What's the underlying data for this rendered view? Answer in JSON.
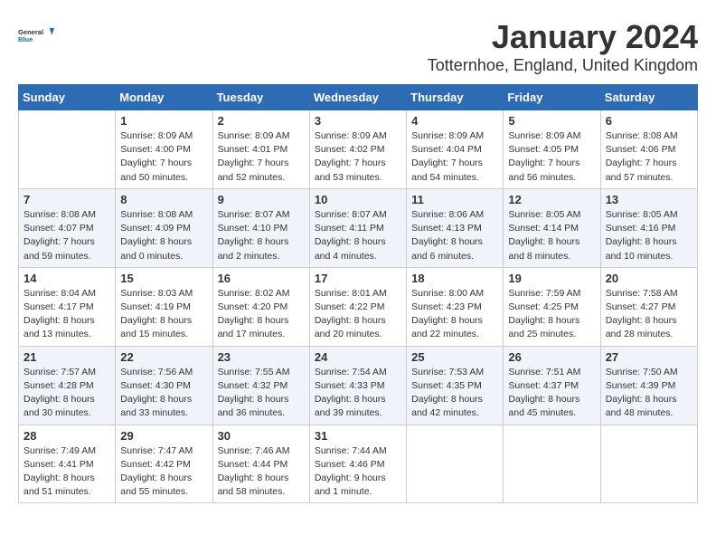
{
  "header": {
    "logo_general": "General",
    "logo_blue": "Blue",
    "month": "January 2024",
    "location": "Totternhoe, England, United Kingdom"
  },
  "days_of_week": [
    "Sunday",
    "Monday",
    "Tuesday",
    "Wednesday",
    "Thursday",
    "Friday",
    "Saturday"
  ],
  "weeks": [
    [
      {
        "day": "",
        "info": ""
      },
      {
        "day": "1",
        "info": "Sunrise: 8:09 AM\nSunset: 4:00 PM\nDaylight: 7 hours\nand 50 minutes."
      },
      {
        "day": "2",
        "info": "Sunrise: 8:09 AM\nSunset: 4:01 PM\nDaylight: 7 hours\nand 52 minutes."
      },
      {
        "day": "3",
        "info": "Sunrise: 8:09 AM\nSunset: 4:02 PM\nDaylight: 7 hours\nand 53 minutes."
      },
      {
        "day": "4",
        "info": "Sunrise: 8:09 AM\nSunset: 4:04 PM\nDaylight: 7 hours\nand 54 minutes."
      },
      {
        "day": "5",
        "info": "Sunrise: 8:09 AM\nSunset: 4:05 PM\nDaylight: 7 hours\nand 56 minutes."
      },
      {
        "day": "6",
        "info": "Sunrise: 8:08 AM\nSunset: 4:06 PM\nDaylight: 7 hours\nand 57 minutes."
      }
    ],
    [
      {
        "day": "7",
        "info": "Sunrise: 8:08 AM\nSunset: 4:07 PM\nDaylight: 7 hours\nand 59 minutes."
      },
      {
        "day": "8",
        "info": "Sunrise: 8:08 AM\nSunset: 4:09 PM\nDaylight: 8 hours\nand 0 minutes."
      },
      {
        "day": "9",
        "info": "Sunrise: 8:07 AM\nSunset: 4:10 PM\nDaylight: 8 hours\nand 2 minutes."
      },
      {
        "day": "10",
        "info": "Sunrise: 8:07 AM\nSunset: 4:11 PM\nDaylight: 8 hours\nand 4 minutes."
      },
      {
        "day": "11",
        "info": "Sunrise: 8:06 AM\nSunset: 4:13 PM\nDaylight: 8 hours\nand 6 minutes."
      },
      {
        "day": "12",
        "info": "Sunrise: 8:05 AM\nSunset: 4:14 PM\nDaylight: 8 hours\nand 8 minutes."
      },
      {
        "day": "13",
        "info": "Sunrise: 8:05 AM\nSunset: 4:16 PM\nDaylight: 8 hours\nand 10 minutes."
      }
    ],
    [
      {
        "day": "14",
        "info": "Sunrise: 8:04 AM\nSunset: 4:17 PM\nDaylight: 8 hours\nand 13 minutes."
      },
      {
        "day": "15",
        "info": "Sunrise: 8:03 AM\nSunset: 4:19 PM\nDaylight: 8 hours\nand 15 minutes."
      },
      {
        "day": "16",
        "info": "Sunrise: 8:02 AM\nSunset: 4:20 PM\nDaylight: 8 hours\nand 17 minutes."
      },
      {
        "day": "17",
        "info": "Sunrise: 8:01 AM\nSunset: 4:22 PM\nDaylight: 8 hours\nand 20 minutes."
      },
      {
        "day": "18",
        "info": "Sunrise: 8:00 AM\nSunset: 4:23 PM\nDaylight: 8 hours\nand 22 minutes."
      },
      {
        "day": "19",
        "info": "Sunrise: 7:59 AM\nSunset: 4:25 PM\nDaylight: 8 hours\nand 25 minutes."
      },
      {
        "day": "20",
        "info": "Sunrise: 7:58 AM\nSunset: 4:27 PM\nDaylight: 8 hours\nand 28 minutes."
      }
    ],
    [
      {
        "day": "21",
        "info": "Sunrise: 7:57 AM\nSunset: 4:28 PM\nDaylight: 8 hours\nand 30 minutes."
      },
      {
        "day": "22",
        "info": "Sunrise: 7:56 AM\nSunset: 4:30 PM\nDaylight: 8 hours\nand 33 minutes."
      },
      {
        "day": "23",
        "info": "Sunrise: 7:55 AM\nSunset: 4:32 PM\nDaylight: 8 hours\nand 36 minutes."
      },
      {
        "day": "24",
        "info": "Sunrise: 7:54 AM\nSunset: 4:33 PM\nDaylight: 8 hours\nand 39 minutes."
      },
      {
        "day": "25",
        "info": "Sunrise: 7:53 AM\nSunset: 4:35 PM\nDaylight: 8 hours\nand 42 minutes."
      },
      {
        "day": "26",
        "info": "Sunrise: 7:51 AM\nSunset: 4:37 PM\nDaylight: 8 hours\nand 45 minutes."
      },
      {
        "day": "27",
        "info": "Sunrise: 7:50 AM\nSunset: 4:39 PM\nDaylight: 8 hours\nand 48 minutes."
      }
    ],
    [
      {
        "day": "28",
        "info": "Sunrise: 7:49 AM\nSunset: 4:41 PM\nDaylight: 8 hours\nand 51 minutes."
      },
      {
        "day": "29",
        "info": "Sunrise: 7:47 AM\nSunset: 4:42 PM\nDaylight: 8 hours\nand 55 minutes."
      },
      {
        "day": "30",
        "info": "Sunrise: 7:46 AM\nSunset: 4:44 PM\nDaylight: 8 hours\nand 58 minutes."
      },
      {
        "day": "31",
        "info": "Sunrise: 7:44 AM\nSunset: 4:46 PM\nDaylight: 9 hours\nand 1 minute."
      },
      {
        "day": "",
        "info": ""
      },
      {
        "day": "",
        "info": ""
      },
      {
        "day": "",
        "info": ""
      }
    ]
  ]
}
